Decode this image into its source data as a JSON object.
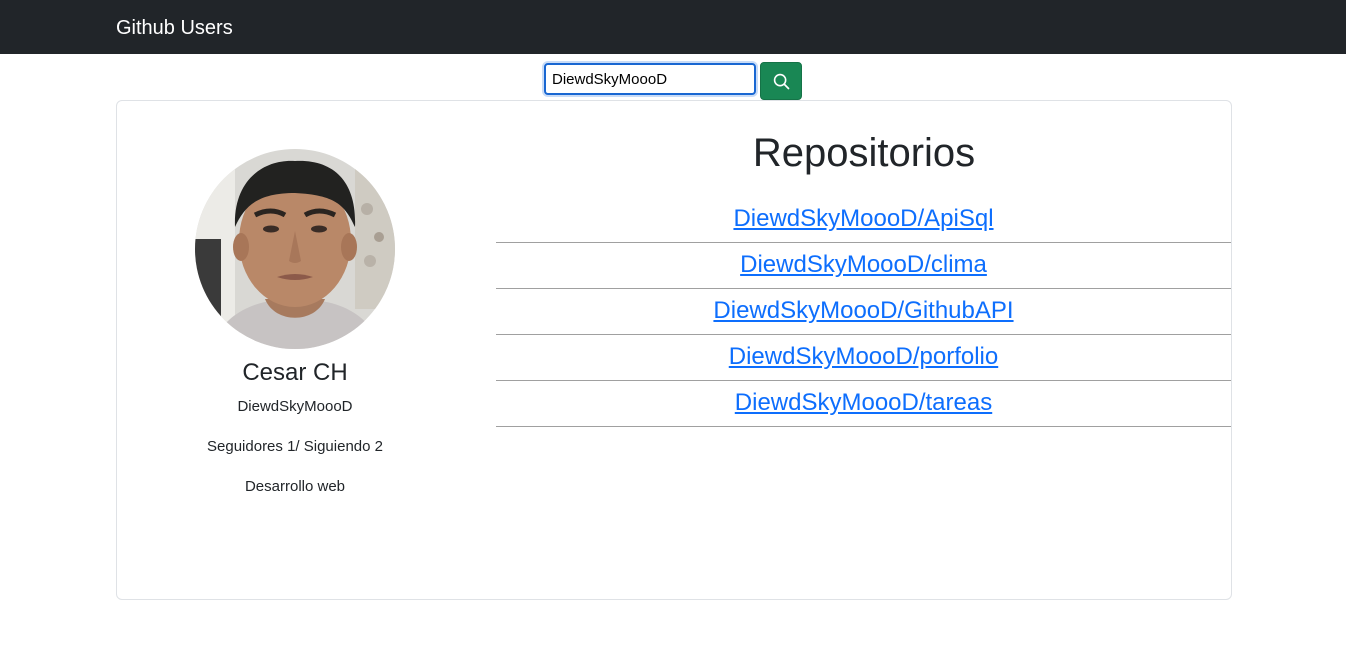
{
  "navbar": {
    "brand": "Github Users"
  },
  "search": {
    "value": "DiewdSkyMoooD",
    "button_icon": "search-icon"
  },
  "colors": {
    "navbar_bg": "#212529",
    "search_button": "#198754",
    "link": "#0d6efd"
  },
  "profile": {
    "name": "Cesar CH",
    "login": "DiewdSkyMoooD",
    "followers_label": "Seguidores 1/ Siguiendo 2",
    "bio": "Desarrollo web"
  },
  "repos": {
    "title": "Repositorios",
    "items": [
      {
        "label": "DiewdSkyMoooD/ApiSql"
      },
      {
        "label": "DiewdSkyMoooD/clima"
      },
      {
        "label": "DiewdSkyMoooD/GithubAPI"
      },
      {
        "label": "DiewdSkyMoooD/porfolio"
      },
      {
        "label": "DiewdSkyMoooD/tareas"
      }
    ]
  }
}
